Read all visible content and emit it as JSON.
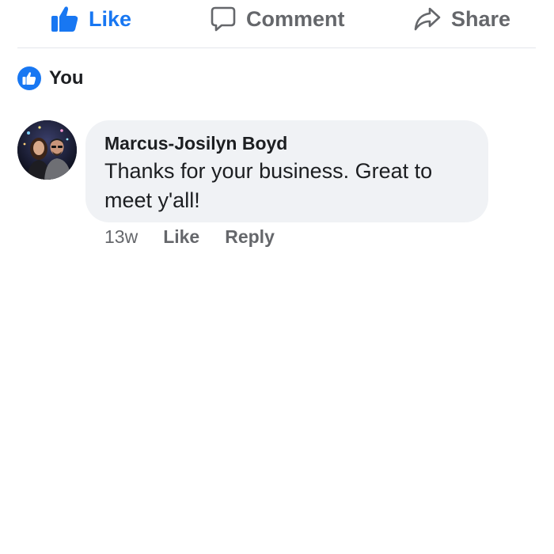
{
  "actions": {
    "like_label": "Like",
    "comment_label": "Comment",
    "share_label": "Share"
  },
  "reactions": {
    "summary": "You"
  },
  "comment": {
    "author": "Marcus-Josilyn Boyd",
    "text": "Thanks for your business. Great to meet y'all!",
    "timestamp": "13w",
    "like_label": "Like",
    "reply_label": "Reply"
  },
  "icons": {
    "like": "thumbs-up-icon",
    "comment": "speech-bubble-icon",
    "share": "share-arrow-icon",
    "reaction": "like-reaction-icon"
  },
  "colors": {
    "accent": "#1877f2",
    "secondary_text": "#65676b",
    "bubble_background": "#f0f2f5",
    "divider": "#e4e6eb"
  }
}
